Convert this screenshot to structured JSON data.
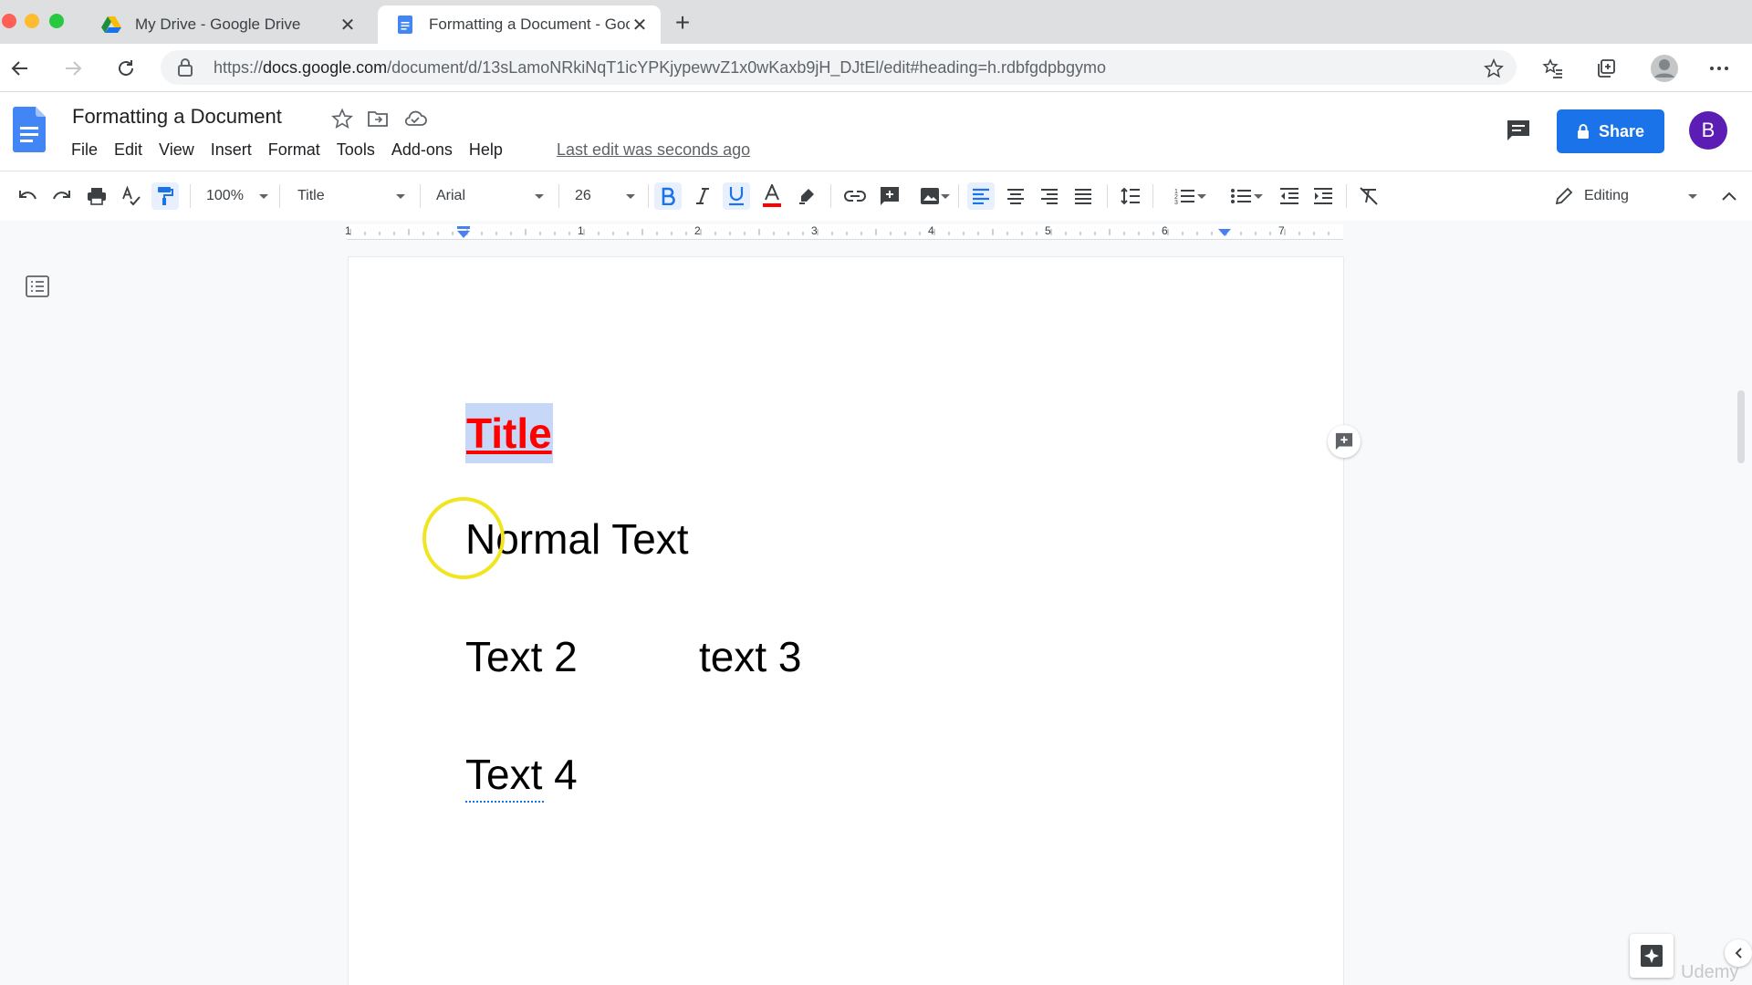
{
  "browser": {
    "tabs": [
      {
        "label": "My Drive - Google Drive",
        "active": false
      },
      {
        "label": "Formatting a Document - Google Docs",
        "active": true
      }
    ],
    "url": {
      "scheme": "https://",
      "host": "docs.google.com",
      "path": "/document/d/13sLamoNRkiNqT1icYPKjypewvZ1x0wKaxb9jH_DJtEl/edit#heading=h.rdbfgdpbgymo"
    }
  },
  "docs_header": {
    "title": "Formatting a Document",
    "menu": [
      "File",
      "Edit",
      "View",
      "Insert",
      "Format",
      "Tools",
      "Add-ons",
      "Help"
    ],
    "last_edit": "Last edit was seconds ago",
    "share_label": "Share",
    "avatar_initial": "B"
  },
  "toolbar": {
    "zoom": "100%",
    "style": "Title",
    "font": "Arial",
    "font_size": "26",
    "mode": "Editing"
  },
  "ruler": {
    "numbers": [
      "1",
      "1",
      "2",
      "3",
      "4",
      "5",
      "6",
      "7"
    ]
  },
  "document": {
    "title_text": "Title",
    "normal_text": "Normal Text",
    "text2": "Text 2",
    "text3": "text 3",
    "text4": "Text 4"
  },
  "watermark": "Udemy",
  "colors": {
    "accent": "#1a73e8",
    "title_red": "#ff0000",
    "selection": "#c7d7f7",
    "avatar": "#5b1db4"
  }
}
